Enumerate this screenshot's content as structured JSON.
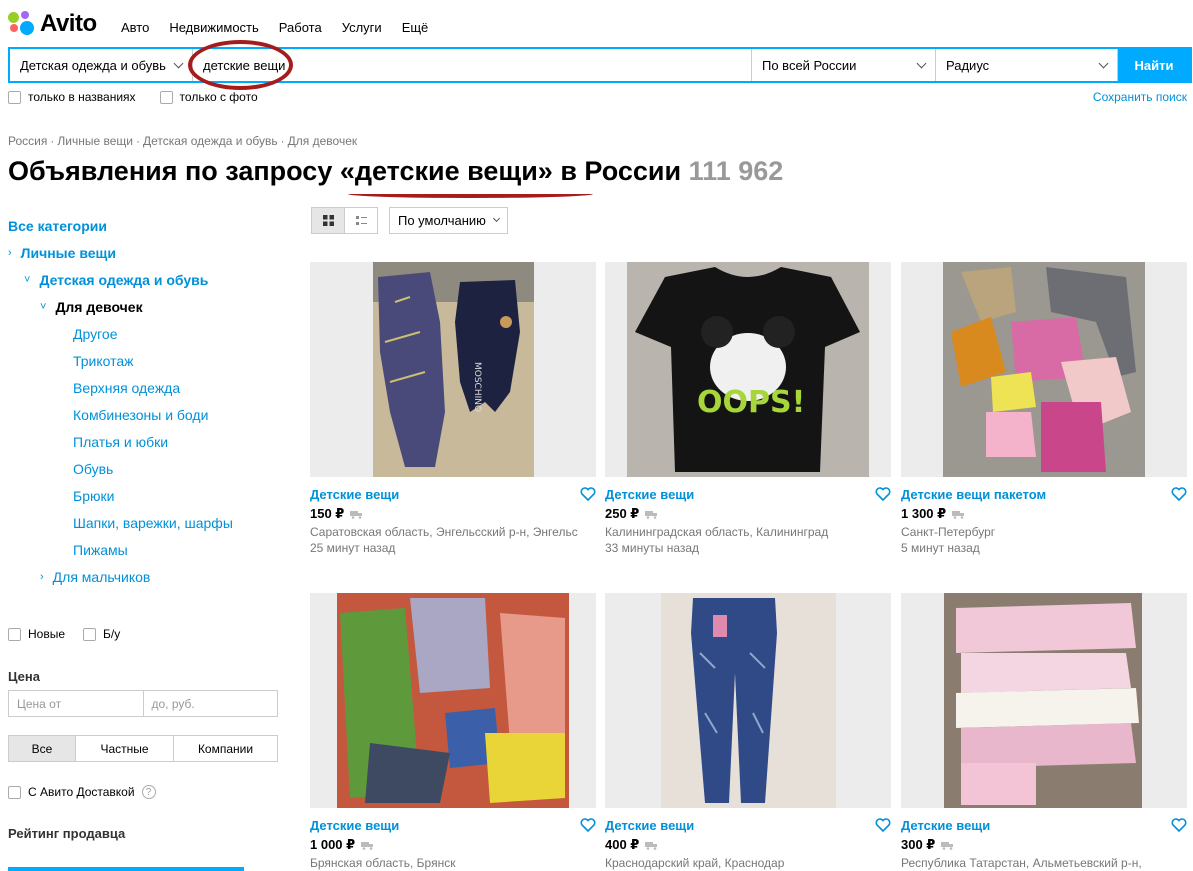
{
  "header": {
    "logo_text": "Avito",
    "nav": [
      "Авто",
      "Недвижимость",
      "Работа",
      "Услуги",
      "Ещё"
    ]
  },
  "search": {
    "category": "Детская одежда и обувь",
    "query": "детские вещи",
    "region": "По всей России",
    "radius": "Радиус",
    "button": "Найти",
    "only_titles": "только в названиях",
    "only_photo": "только с фото",
    "save": "Сохранить поиск"
  },
  "breadcrumb": [
    "Россия",
    "Личные вещи",
    "Детская одежда и обувь",
    "Для девочек"
  ],
  "title": {
    "prefix": "Объявления по запросу ",
    "query": "«детские вещи»",
    "suffix": " в России ",
    "count": "111 962"
  },
  "sidebar": {
    "all": "Все категории",
    "personal": "Личные вещи",
    "kids": "Детская одежда и обувь",
    "girls": "Для девочек",
    "subs": [
      "Другое",
      "Трикотаж",
      "Верхняя одежда",
      "Комбинезоны и боди",
      "Платья и юбки",
      "Обувь",
      "Брюки",
      "Шапки, варежки, шарфы",
      "Пижамы"
    ],
    "boys": "Для мальчиков",
    "cond_new": "Новые",
    "cond_used": "Б/у",
    "price_label": "Цена",
    "price_from": "Цена от",
    "price_to": "до, руб.",
    "seller": [
      "Все",
      "Частные",
      "Компании"
    ],
    "delivery": "С Авито Доставкой",
    "rating": "Рейтинг продавца"
  },
  "toolbar": {
    "sort": "По умолчанию"
  },
  "listings": [
    {
      "title": "Детские вещи",
      "price": "150 ₽",
      "loc": "Саратовская область, Энгельсский р-н, Энгельс",
      "time": "25 минут назад"
    },
    {
      "title": "Детские вещи",
      "price": "250 ₽",
      "loc": "Калининградская область, Калининград",
      "time": "33 минуты назад"
    },
    {
      "title": "Детские вещи пакетом",
      "price": "1 300 ₽",
      "loc": "Санкт-Петербург",
      "time": "5 минут назад"
    },
    {
      "title": "Детские вещи",
      "price": "1 000 ₽",
      "loc": "Брянская область, Брянск",
      "time": ""
    },
    {
      "title": "Детские вещи",
      "price": "400 ₽",
      "loc": "Краснодарский край, Краснодар",
      "time": ""
    },
    {
      "title": "Детские вещи",
      "price": "300 ₽",
      "loc": "Республика Татарстан, Альметьевский р-н,",
      "time": ""
    }
  ],
  "colors": {
    "accent": "#00aaff",
    "link": "#0091d9",
    "annotation": "#a51c1c"
  }
}
